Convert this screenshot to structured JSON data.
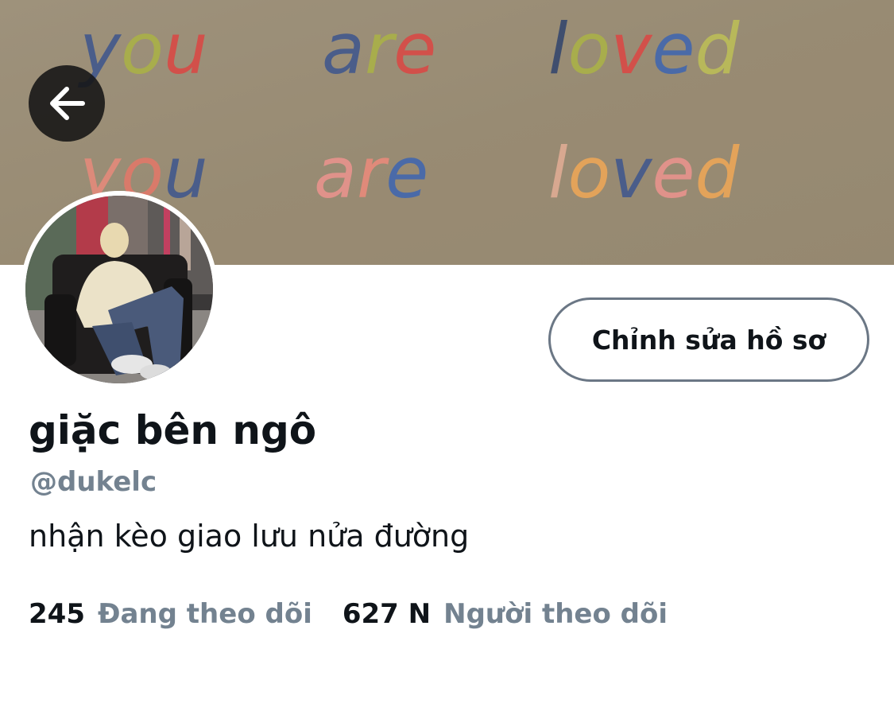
{
  "header": {
    "banner": {
      "line1": [
        "you",
        "are",
        "loved"
      ],
      "line2": [
        "you",
        "are",
        "loved"
      ]
    },
    "back_icon": "arrow-left-icon"
  },
  "profile": {
    "edit_label": "Chỉnh sửa hồ sơ",
    "display_name": "giặc bên ngô",
    "handle": "@dukelc",
    "bio": "nhận kèo giao lưu nửa đường"
  },
  "stats": {
    "following_count": "245",
    "following_label": "Đang theo dõi",
    "followers_count": "627 N",
    "followers_label": "Người theo dõi"
  },
  "colors": {
    "text_primary": "#0f1419",
    "text_secondary": "#738290",
    "border": "#6b7785"
  }
}
